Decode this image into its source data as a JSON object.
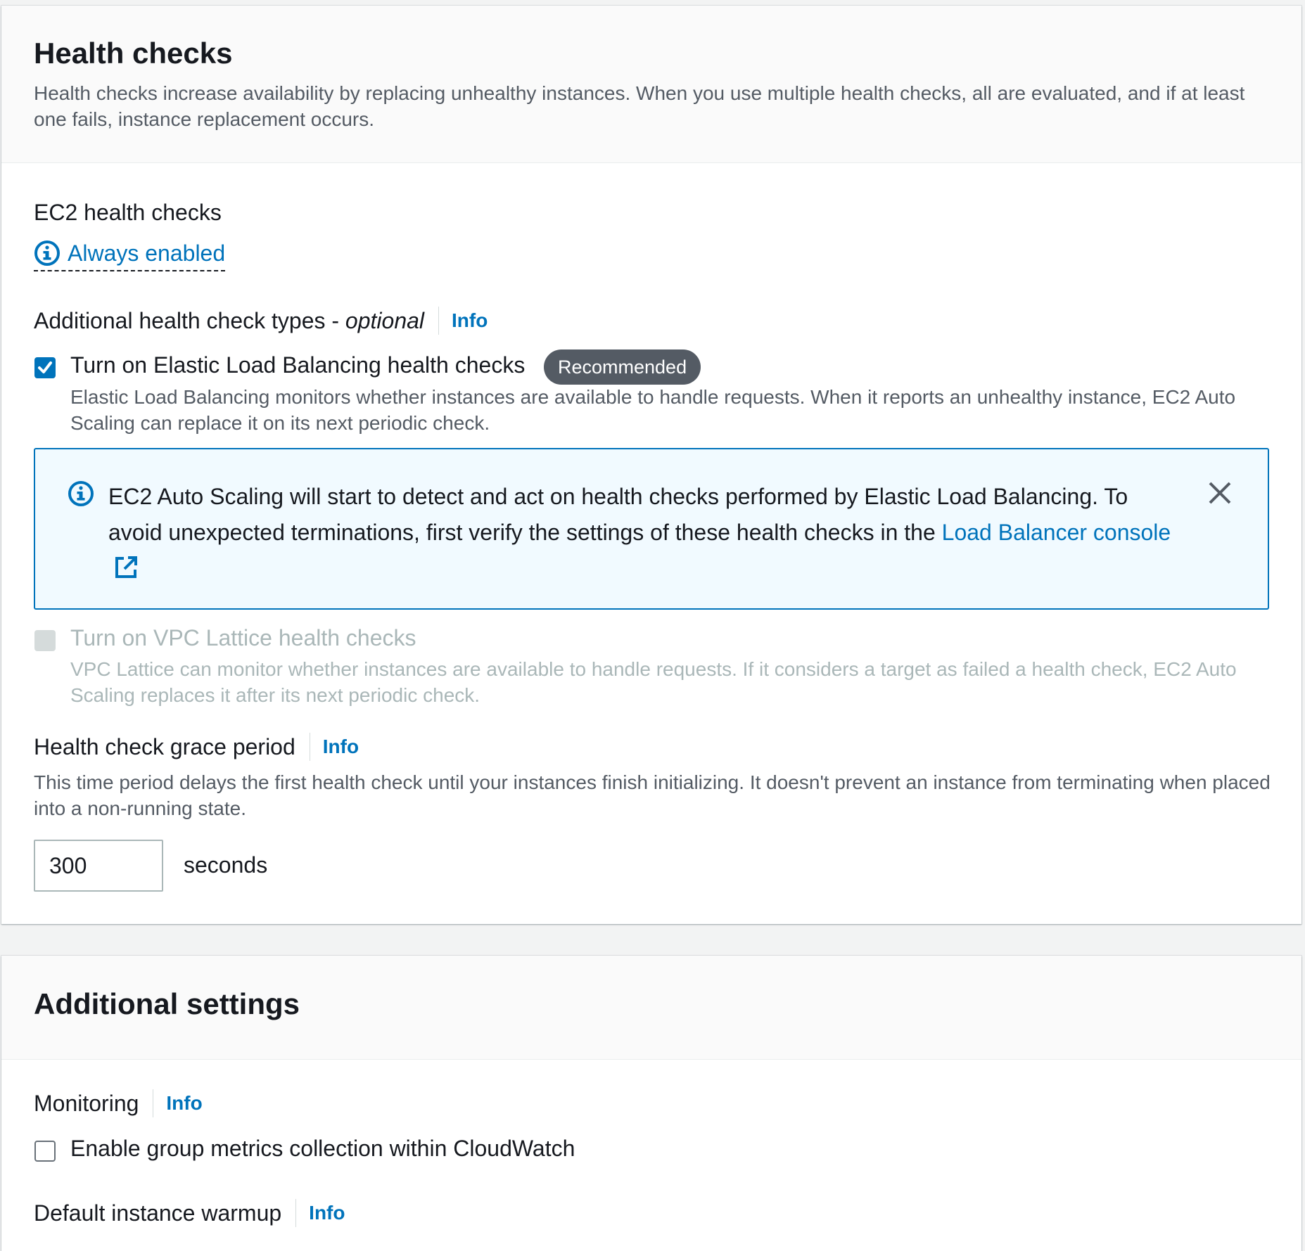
{
  "health": {
    "title": "Health checks",
    "description": "Health checks increase availability by replacing unhealthy instances. When you use multiple health checks, all are evaluated, and if at least one fails, instance replacement occurs.",
    "ec2_label": "EC2 health checks",
    "always_enabled": "Always enabled",
    "additional_types_label": "Additional health check types - ",
    "additional_types_optional": "optional",
    "info": "Info",
    "elb": {
      "label": "Turn on Elastic Load Balancing health checks",
      "checked": true,
      "badge": "Recommended",
      "description": "Elastic Load Balancing monitors whether instances are available to handle requests. When it reports an unhealthy instance, EC2 Auto Scaling can replace it on its next periodic check."
    },
    "alert": {
      "text": "EC2 Auto Scaling will start to detect and act on health checks performed by Elastic Load Balancing. To avoid unexpected terminations, first verify the settings of these health checks in the ",
      "link": "Load Balancer console"
    },
    "vpc": {
      "label": "Turn on VPC Lattice health checks",
      "disabled": true,
      "description": "VPC Lattice can monitor whether instances are available to handle requests. If it considers a target as failed a health check, EC2 Auto Scaling replaces it after its next periodic check."
    },
    "grace": {
      "label": "Health check grace period",
      "info": "Info",
      "description": "This time period delays the first health check until your instances finish initializing. It doesn't prevent an instance from terminating when placed into a non-running state.",
      "value": "300",
      "unit": "seconds"
    }
  },
  "additional": {
    "title": "Additional settings",
    "monitoring_label": "Monitoring",
    "info": "Info",
    "metrics_label": "Enable group metrics collection within CloudWatch",
    "metrics_checked": false,
    "warmup_label": "Default instance warmup",
    "warmup_info": "Info"
  }
}
